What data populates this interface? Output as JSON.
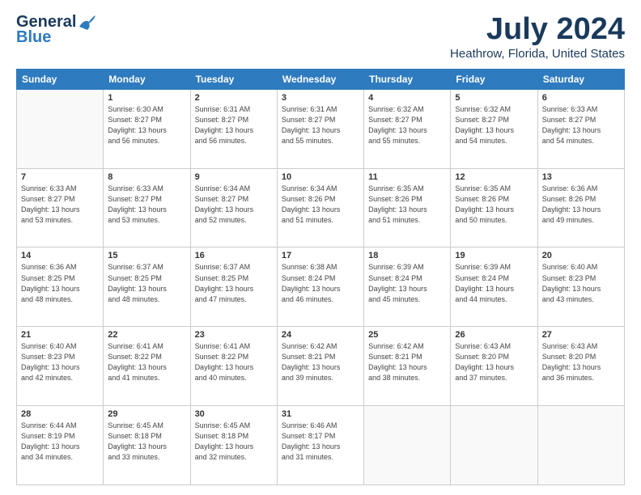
{
  "header": {
    "logo_line1": "General",
    "logo_line2": "Blue",
    "month": "July 2024",
    "location": "Heathrow, Florida, United States"
  },
  "weekdays": [
    "Sunday",
    "Monday",
    "Tuesday",
    "Wednesday",
    "Thursday",
    "Friday",
    "Saturday"
  ],
  "weeks": [
    [
      {
        "day": "",
        "info": ""
      },
      {
        "day": "1",
        "info": "Sunrise: 6:30 AM\nSunset: 8:27 PM\nDaylight: 13 hours\nand 56 minutes."
      },
      {
        "day": "2",
        "info": "Sunrise: 6:31 AM\nSunset: 8:27 PM\nDaylight: 13 hours\nand 56 minutes."
      },
      {
        "day": "3",
        "info": "Sunrise: 6:31 AM\nSunset: 8:27 PM\nDaylight: 13 hours\nand 55 minutes."
      },
      {
        "day": "4",
        "info": "Sunrise: 6:32 AM\nSunset: 8:27 PM\nDaylight: 13 hours\nand 55 minutes."
      },
      {
        "day": "5",
        "info": "Sunrise: 6:32 AM\nSunset: 8:27 PM\nDaylight: 13 hours\nand 54 minutes."
      },
      {
        "day": "6",
        "info": "Sunrise: 6:33 AM\nSunset: 8:27 PM\nDaylight: 13 hours\nand 54 minutes."
      }
    ],
    [
      {
        "day": "7",
        "info": "Sunrise: 6:33 AM\nSunset: 8:27 PM\nDaylight: 13 hours\nand 53 minutes."
      },
      {
        "day": "8",
        "info": "Sunrise: 6:33 AM\nSunset: 8:27 PM\nDaylight: 13 hours\nand 53 minutes."
      },
      {
        "day": "9",
        "info": "Sunrise: 6:34 AM\nSunset: 8:27 PM\nDaylight: 13 hours\nand 52 minutes."
      },
      {
        "day": "10",
        "info": "Sunrise: 6:34 AM\nSunset: 8:26 PM\nDaylight: 13 hours\nand 51 minutes."
      },
      {
        "day": "11",
        "info": "Sunrise: 6:35 AM\nSunset: 8:26 PM\nDaylight: 13 hours\nand 51 minutes."
      },
      {
        "day": "12",
        "info": "Sunrise: 6:35 AM\nSunset: 8:26 PM\nDaylight: 13 hours\nand 50 minutes."
      },
      {
        "day": "13",
        "info": "Sunrise: 6:36 AM\nSunset: 8:26 PM\nDaylight: 13 hours\nand 49 minutes."
      }
    ],
    [
      {
        "day": "14",
        "info": "Sunrise: 6:36 AM\nSunset: 8:25 PM\nDaylight: 13 hours\nand 48 minutes."
      },
      {
        "day": "15",
        "info": "Sunrise: 6:37 AM\nSunset: 8:25 PM\nDaylight: 13 hours\nand 48 minutes."
      },
      {
        "day": "16",
        "info": "Sunrise: 6:37 AM\nSunset: 8:25 PM\nDaylight: 13 hours\nand 47 minutes."
      },
      {
        "day": "17",
        "info": "Sunrise: 6:38 AM\nSunset: 8:24 PM\nDaylight: 13 hours\nand 46 minutes."
      },
      {
        "day": "18",
        "info": "Sunrise: 6:39 AM\nSunset: 8:24 PM\nDaylight: 13 hours\nand 45 minutes."
      },
      {
        "day": "19",
        "info": "Sunrise: 6:39 AM\nSunset: 8:24 PM\nDaylight: 13 hours\nand 44 minutes."
      },
      {
        "day": "20",
        "info": "Sunrise: 6:40 AM\nSunset: 8:23 PM\nDaylight: 13 hours\nand 43 minutes."
      }
    ],
    [
      {
        "day": "21",
        "info": "Sunrise: 6:40 AM\nSunset: 8:23 PM\nDaylight: 13 hours\nand 42 minutes."
      },
      {
        "day": "22",
        "info": "Sunrise: 6:41 AM\nSunset: 8:22 PM\nDaylight: 13 hours\nand 41 minutes."
      },
      {
        "day": "23",
        "info": "Sunrise: 6:41 AM\nSunset: 8:22 PM\nDaylight: 13 hours\nand 40 minutes."
      },
      {
        "day": "24",
        "info": "Sunrise: 6:42 AM\nSunset: 8:21 PM\nDaylight: 13 hours\nand 39 minutes."
      },
      {
        "day": "25",
        "info": "Sunrise: 6:42 AM\nSunset: 8:21 PM\nDaylight: 13 hours\nand 38 minutes."
      },
      {
        "day": "26",
        "info": "Sunrise: 6:43 AM\nSunset: 8:20 PM\nDaylight: 13 hours\nand 37 minutes."
      },
      {
        "day": "27",
        "info": "Sunrise: 6:43 AM\nSunset: 8:20 PM\nDaylight: 13 hours\nand 36 minutes."
      }
    ],
    [
      {
        "day": "28",
        "info": "Sunrise: 6:44 AM\nSunset: 8:19 PM\nDaylight: 13 hours\nand 34 minutes."
      },
      {
        "day": "29",
        "info": "Sunrise: 6:45 AM\nSunset: 8:18 PM\nDaylight: 13 hours\nand 33 minutes."
      },
      {
        "day": "30",
        "info": "Sunrise: 6:45 AM\nSunset: 8:18 PM\nDaylight: 13 hours\nand 32 minutes."
      },
      {
        "day": "31",
        "info": "Sunrise: 6:46 AM\nSunset: 8:17 PM\nDaylight: 13 hours\nand 31 minutes."
      },
      {
        "day": "",
        "info": ""
      },
      {
        "day": "",
        "info": ""
      },
      {
        "day": "",
        "info": ""
      }
    ]
  ]
}
